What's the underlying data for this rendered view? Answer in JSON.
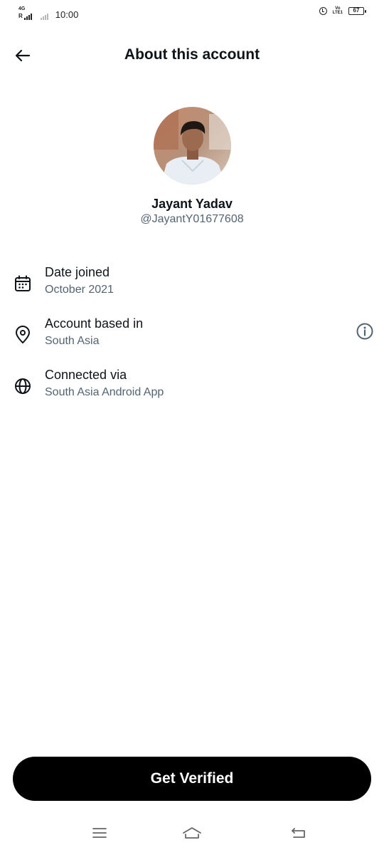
{
  "status_bar": {
    "network_tag": "4G",
    "roaming_tag": "R",
    "time": "10:00",
    "volte_line1": "Vo",
    "volte_line2": "LTE1",
    "battery": "67"
  },
  "header": {
    "title": "About this account",
    "back_icon": "arrow-left-icon"
  },
  "profile": {
    "display_name": "Jayant Yadav",
    "handle": "@JayantY01677608"
  },
  "info_rows": [
    {
      "label": "Date joined",
      "value": "October 2021",
      "icon": "calendar-icon"
    },
    {
      "label": "Account based in",
      "value": "South Asia",
      "icon": "location-pin-icon"
    },
    {
      "label": "Connected via",
      "value": "South Asia Android App",
      "icon": "globe-icon"
    }
  ],
  "cta": {
    "label": "Get Verified"
  },
  "colors": {
    "primary_text": "#0f1419",
    "secondary_text": "#536471",
    "button_bg": "#000000",
    "button_text": "#ffffff"
  }
}
